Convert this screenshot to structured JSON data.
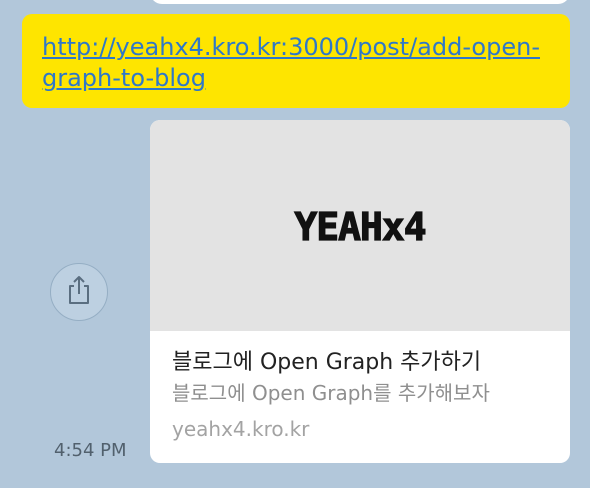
{
  "link_message": {
    "url_text": "http://yeahx4.kro.kr:3000/post/add-open-graph-to-blog"
  },
  "link_preview": {
    "image_alt": "YEAHx4",
    "title": "블로그에 Open Graph 추가하기",
    "description": "블로그에 Open Graph를 추가해보자",
    "domain": "yeahx4.kro.kr"
  },
  "message_meta": {
    "time": "4:54 PM"
  },
  "icons": {
    "share": "share-icon"
  },
  "colors": {
    "chat_background": "#b2c7da",
    "my_bubble": "#fee500",
    "link": "#2f78c8",
    "card_image_background": "#e3e3e3"
  }
}
